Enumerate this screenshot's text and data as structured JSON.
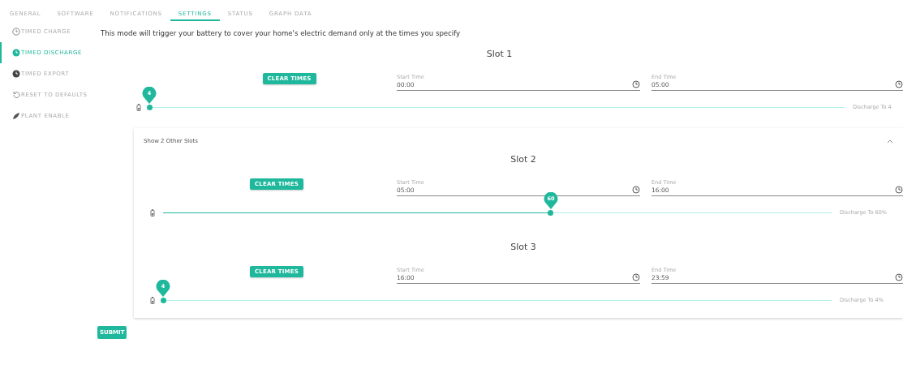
{
  "tabs": [
    {
      "label": "GENERAL",
      "selected": false
    },
    {
      "label": "SOFTWARE",
      "selected": false
    },
    {
      "label": "NOTIFICATIONS",
      "selected": false
    },
    {
      "label": "SETTINGS",
      "selected": true
    },
    {
      "label": "STATUS",
      "selected": false
    },
    {
      "label": "GRAPH DATA",
      "selected": false
    }
  ],
  "sidebar": {
    "items": [
      {
        "label": "TIMED CHARGE",
        "kind": "charge",
        "selected": false
      },
      {
        "label": "TIMED DISCHARGE",
        "kind": "discharge",
        "selected": true
      },
      {
        "label": "TIMED EXPORT",
        "kind": "export",
        "selected": false
      },
      {
        "label": "RESET TO DEFAULTS",
        "kind": "reset",
        "selected": false
      },
      {
        "label": "PLANT ENABLE",
        "kind": "plant",
        "selected": false
      }
    ]
  },
  "description": "This mode will trigger your battery to cover your home's electric demand only at the times you specify",
  "slots": [
    {
      "title": "Slot 1",
      "clear_button": "CLEAR TIMES",
      "start_time": {
        "label": "Start Time",
        "value": "00:00"
      },
      "end_time": {
        "label": "End Time",
        "value": "05:00"
      },
      "slider": {
        "bubble": "4",
        "level": 0.0,
        "reading": "Discharge To 4"
      }
    }
  ],
  "other_slots": {
    "toggle": "Show 2 Other Slots",
    "expanded": true,
    "slots": [
      {
        "title": "Slot 2",
        "clear_button": "CLEAR TIMES",
        "start_time": {
          "label": "Start Time",
          "value": "05:00"
        },
        "end_time": {
          "label": "End Time",
          "value": "16:00"
        },
        "slider": {
          "bubble": "60",
          "level": 0.58,
          "reading": "Discharge To 60%"
        }
      },
      {
        "title": "Slot 3",
        "clear_button": "CLEAR TIMES",
        "start_time": {
          "label": "Start Time",
          "value": "16:00"
        },
        "end_time": {
          "label": "End Time",
          "value": "23:59"
        },
        "slider": {
          "bubble": "4",
          "level": 0.0,
          "reading": "Discharge To 4%"
        }
      }
    ]
  },
  "submit": "SUBMIT"
}
